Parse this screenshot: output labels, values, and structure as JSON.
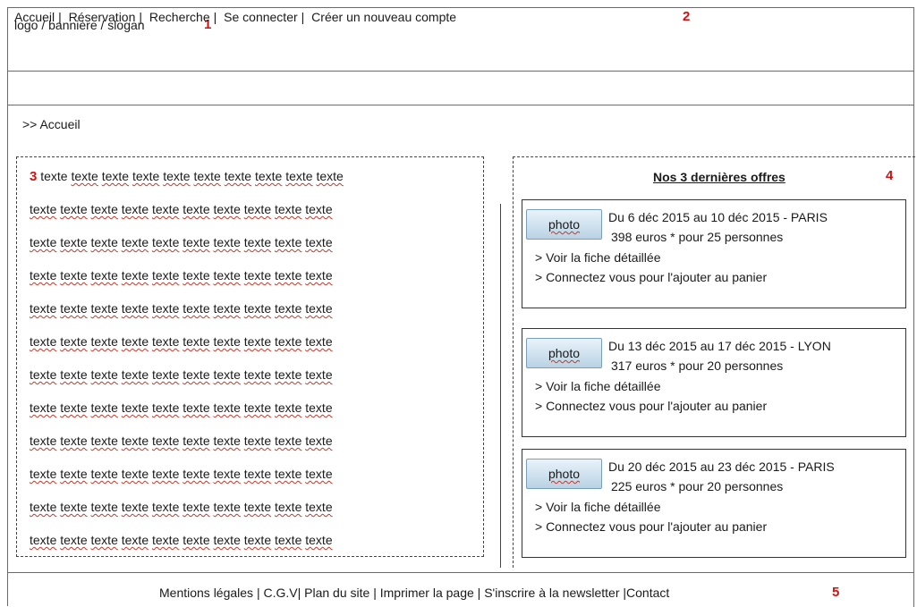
{
  "banner": {
    "text": "logo / bannière / slogan",
    "marker": "1"
  },
  "nav": {
    "items": [
      "Accueil",
      "Réservation",
      "Recherche",
      "Se connecter",
      "Créer un nouveau compte"
    ],
    "marker": "2"
  },
  "breadcrumb": ">> Accueil",
  "content": {
    "marker": "3",
    "lines": [
      "texte texte texte texte texte texte texte texte texte texte",
      "texte texte texte texte texte texte texte texte texte texte",
      "texte texte texte texte texte texte texte texte texte texte",
      "texte texte texte texte texte texte texte texte texte texte",
      "texte texte texte texte texte texte texte texte texte texte",
      "texte texte texte texte texte texte texte texte texte texte",
      "texte texte texte texte texte texte texte texte texte texte",
      "texte texte texte texte texte texte texte texte texte texte",
      "texte texte texte texte texte texte texte texte texte texte",
      "texte texte texte texte texte texte texte texte texte texte",
      "texte texte texte texte texte texte texte texte texte texte",
      "texte texte texte texte texte texte texte texte texte texte"
    ]
  },
  "offers": {
    "title": "Nos 3 dernières offres",
    "marker": "4",
    "photo_label": "photo",
    "details_link": "> Voir la fiche détaillée",
    "cart_link": "> Connectez vous pour l'ajouter au panier",
    "items": [
      {
        "dates": "Du 6 déc 2015 au 10 déc 2015 - PARIS",
        "price": "398 euros * pour 25 personnes"
      },
      {
        "dates": "Du 13 déc 2015 au 17 déc 2015 - LYON",
        "price": "317 euros * pour 20 personnes"
      },
      {
        "dates": "Du 20 déc 2015 au 23 déc 2015 - PARIS",
        "price": "225 euros * pour 20 personnes"
      }
    ]
  },
  "footer": {
    "links": [
      "Mentions légales",
      "C.G.V",
      "Plan du site",
      "Imprimer la page",
      "S'inscrire à la newsletter",
      "Contact"
    ],
    "marker": "5"
  },
  "colors": {
    "marker": "#d01010",
    "border": "#6b6b6b",
    "photo_button": "#cfe2ef"
  }
}
